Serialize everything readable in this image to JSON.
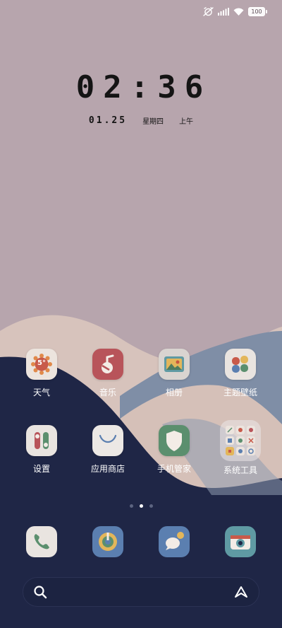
{
  "status_bar": {
    "battery": "100"
  },
  "clock": {
    "time": "02:36",
    "date": "01.25",
    "weekday": "星期四",
    "period": "上午"
  },
  "weather": {
    "temperature": "5°"
  },
  "apps": {
    "weather": "天气",
    "music": "音乐",
    "gallery": "相册",
    "themes": "主题壁纸",
    "settings": "设置",
    "app_store": "应用商店",
    "security": "手机管家",
    "system_tools": "系统工具"
  },
  "pagination": {
    "pages": 3,
    "current": 2
  },
  "colors": {
    "sky": "#b7a5ad",
    "hill_light": "#d9c6be",
    "hill_blue": "#7f8ea5",
    "navy": "#1f2646"
  }
}
